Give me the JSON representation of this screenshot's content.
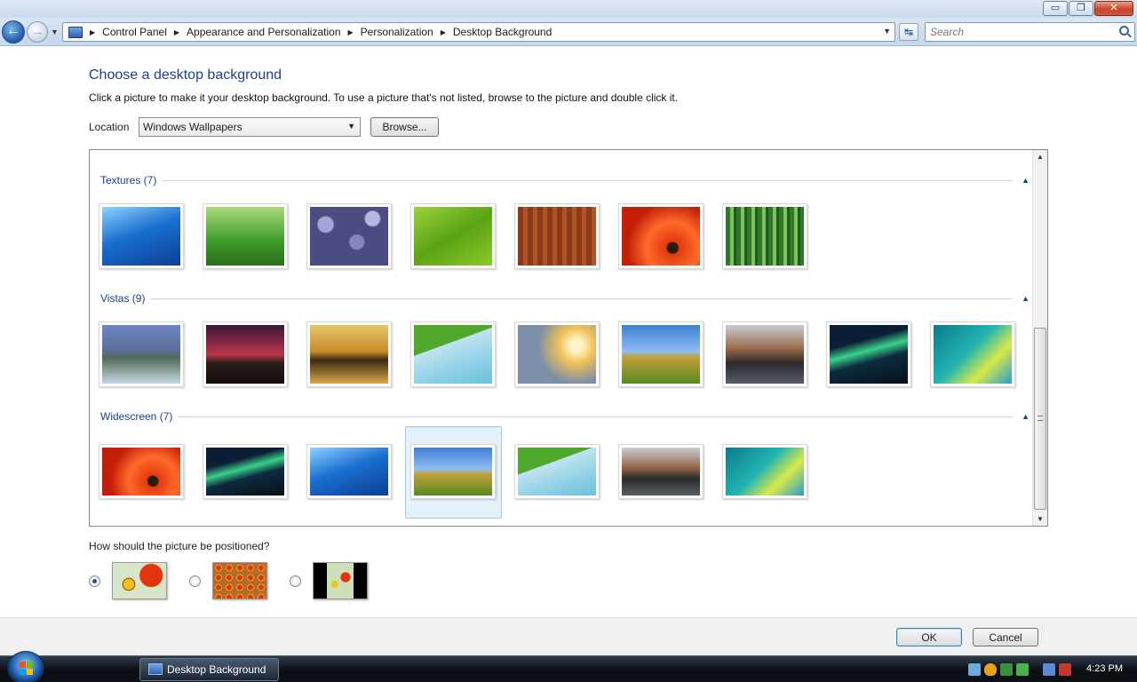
{
  "window": {
    "minimize_glyph": "▭",
    "maximize_glyph": "❐",
    "close_glyph": "✕"
  },
  "nav": {
    "back_glyph": "←",
    "forward_glyph": "→",
    "breadcrumbs": [
      "Control Panel",
      "Appearance and Personalization",
      "Personalization",
      "Desktop Background"
    ],
    "search_placeholder": "Search",
    "refresh_glyph": "↹"
  },
  "content": {
    "heading": "Choose a desktop background",
    "instructions": "Click a picture to make it your desktop background. To use a picture that's not listed, browse to the picture and double click it.",
    "location_label": "Location",
    "location_value": "Windows Wallpapers",
    "browse_label": "Browse...",
    "groups": [
      {
        "title": "Textures (7)",
        "icons": [
          "underwater-fish",
          "green-grass",
          "pebbles",
          "green-leaf",
          "wood-grain",
          "red-flower",
          "bamboo"
        ]
      },
      {
        "title": "Vistas (9)",
        "icons": [
          "mountain-lake",
          "dusk-hills",
          "beach-rocks",
          "palm-frond",
          "grass-sunset",
          "green-hills",
          "rocky-shore",
          "aurora",
          "aero-wave"
        ]
      },
      {
        "title": "Widescreen (7)",
        "icons": [
          "red-flower-wide",
          "aurora-wide",
          "underwater-fish-wide",
          "green-hills-wide",
          "palm-frond-wide",
          "rocky-shore-wide",
          "aero-wave-wide"
        ]
      }
    ],
    "selected": "green-hills-wide",
    "position_question": "How should the picture be positioned?",
    "position_options": [
      "fit-to-screen",
      "tile",
      "center"
    ],
    "position_selected": "fit-to-screen"
  },
  "footer": {
    "ok_label": "OK",
    "cancel_label": "Cancel"
  },
  "taskbar": {
    "task_label": "Desktop Background",
    "clock": "4:23 PM"
  },
  "colors": {
    "accent": "#1e3f8a",
    "selection": "#e5f1fb"
  }
}
